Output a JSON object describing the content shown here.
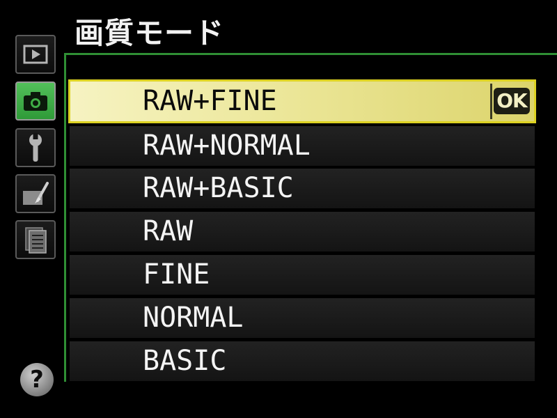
{
  "header": {
    "title": "画質モード"
  },
  "sidebar": {
    "items": [
      {
        "icon": "playback-icon",
        "selected": false
      },
      {
        "icon": "camera-icon",
        "selected": true
      },
      {
        "icon": "wrench-icon",
        "selected": false
      },
      {
        "icon": "retouch-icon",
        "selected": false
      },
      {
        "icon": "my-menu-icon",
        "selected": false
      }
    ],
    "help": {
      "icon": "help-icon",
      "label": "?"
    }
  },
  "menu": {
    "items": [
      {
        "label": "RAW+FINE",
        "selected": true
      },
      {
        "label": "RAW+NORMAL",
        "selected": false
      },
      {
        "label": "RAW+BASIC",
        "selected": false
      },
      {
        "label": "RAW",
        "selected": false
      },
      {
        "label": "FINE",
        "selected": false
      },
      {
        "label": "NORMAL",
        "selected": false
      },
      {
        "label": "BASIC",
        "selected": false
      }
    ],
    "ok_label": "OK"
  },
  "colors": {
    "background": "#000000",
    "frame_green": "#2f8f34",
    "selected_tab_green": "#3fae46",
    "selection_yellow": "#ddd222",
    "text": "#f4f4f4"
  }
}
